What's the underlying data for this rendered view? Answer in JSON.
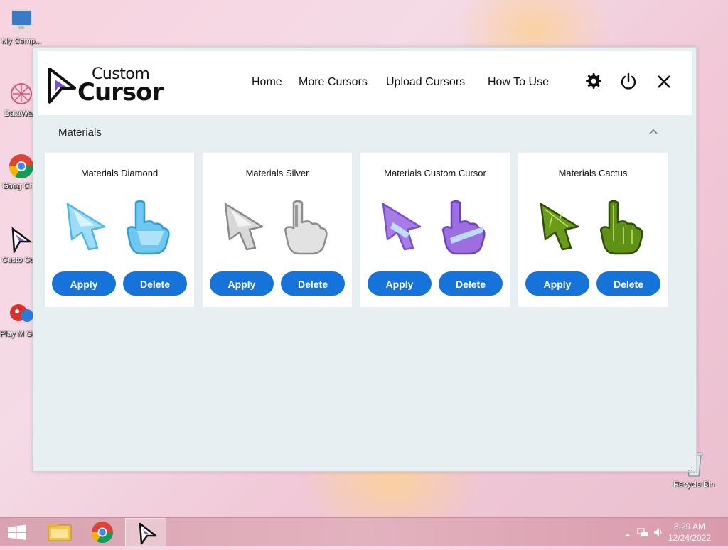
{
  "desktop": {
    "icons": [
      {
        "label": "My Comp..."
      },
      {
        "label": "DataWa..."
      },
      {
        "label": "Goog Chro"
      },
      {
        "label": "Custo Curs"
      },
      {
        "label": "Play M Great G"
      }
    ],
    "recycle_bin": "Recycle Bin"
  },
  "app": {
    "logo": {
      "line1": "Custom",
      "line2": "Cursor"
    },
    "nav": [
      "Home",
      "More Cursors",
      "Upload Cursors",
      "How To Use"
    ],
    "header_icons": [
      "gear-icon",
      "power-icon",
      "close-icon"
    ],
    "section": {
      "title": "Materials",
      "state": "expanded"
    },
    "cards": [
      {
        "title": "Materials Diamond",
        "apply": "Apply",
        "delete": "Delete",
        "theme": "diamond",
        "colors": [
          "#9fdcf7",
          "#4fb6e8"
        ]
      },
      {
        "title": "Materials Silver",
        "apply": "Apply",
        "delete": "Delete",
        "theme": "silver",
        "colors": [
          "#e8e8e8",
          "#9a9a9a"
        ]
      },
      {
        "title": "Materials Custom Cursor",
        "apply": "Apply",
        "delete": "Delete",
        "theme": "custom",
        "colors": [
          "#a87be6",
          "#7a4fd0"
        ]
      },
      {
        "title": "Materials Cactus",
        "apply": "Apply",
        "delete": "Delete",
        "theme": "cactus",
        "colors": [
          "#6a9b1a",
          "#3d6a0c"
        ]
      }
    ]
  },
  "taskbar": {
    "clock_time": "8:29 AM",
    "clock_date": "12/24/2022",
    "apps": [
      "start-button",
      "file-explorer-icon",
      "chrome-icon",
      "custom-cursor-app-icon"
    ]
  },
  "colors": {
    "accent": "#1673d9",
    "window_bg": "#e8eff2",
    "card_bg": "#ffffff"
  }
}
